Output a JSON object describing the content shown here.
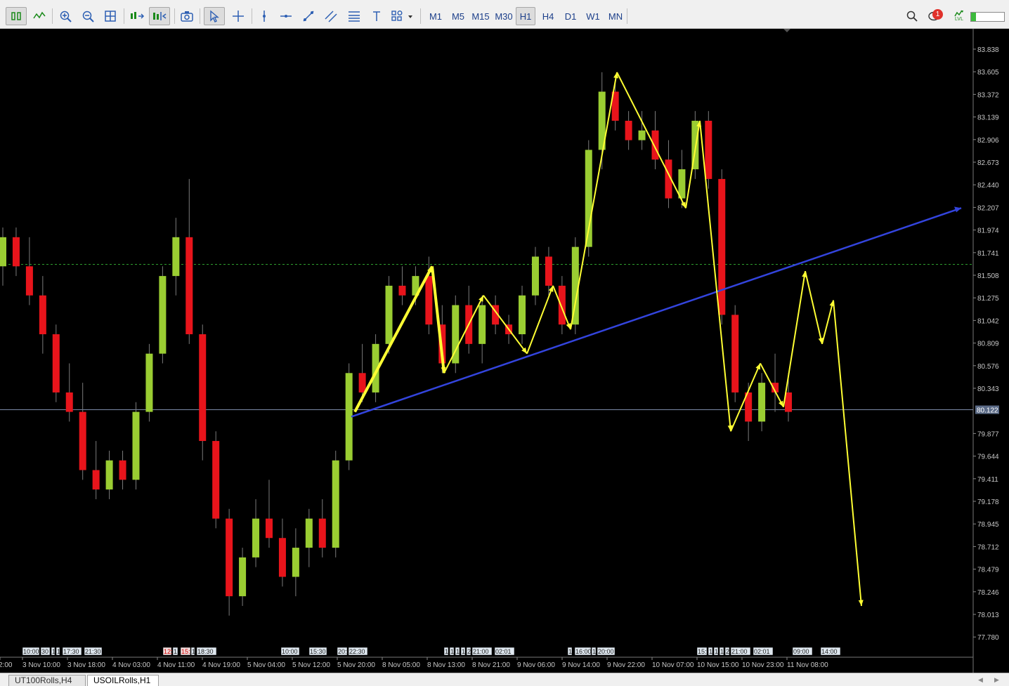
{
  "toolbar": {
    "timeframes": [
      "M1",
      "M5",
      "M15",
      "M30",
      "H1",
      "H4",
      "D1",
      "W1",
      "MN"
    ],
    "active_timeframe": "H1",
    "notification_count": "1",
    "level_label": "LVL",
    "level_fraction": 0.15
  },
  "tabs": [
    {
      "label": "UT100Rolls,H4",
      "active": false
    },
    {
      "label": "USOILRolls,H1",
      "active": true
    }
  ],
  "chart_data": {
    "type": "candlestick",
    "symbol": "USOILRolls",
    "timeframe": "H1",
    "y_axis_ticks": [
      "83.838",
      "83.605",
      "83.372",
      "83.139",
      "82.906",
      "82.673",
      "82.440",
      "82.207",
      "81.974",
      "81.741",
      "81.508",
      "81.275",
      "81.042",
      "80.809",
      "80.576",
      "80.343",
      "79.877",
      "79.644",
      "79.411",
      "79.178",
      "78.945",
      "78.712",
      "78.479",
      "78.246",
      "78.013",
      "77.780"
    ],
    "ylim": [
      77.6,
      83.95
    ],
    "current_price": "80.122",
    "dashed_level": 81.62,
    "x_axis_labels": [
      "2:00",
      "3 Nov 10:00",
      "3 Nov 18:00",
      "4 Nov 03:00",
      "4 Nov 11:00",
      "4 Nov 19:00",
      "5 Nov 04:00",
      "5 Nov 12:00",
      "5 Nov 20:00",
      "8 Nov 05:00",
      "8 Nov 13:00",
      "8 Nov 21:00",
      "9 Nov 06:00",
      "9 Nov 14:00",
      "9 Nov 22:00",
      "10 Nov 07:00",
      "10 Nov 15:00",
      "10 Nov 23:00",
      "11 Nov 08:00"
    ],
    "event_markers": [
      "10:00",
      "30",
      "1",
      "1",
      "17:30",
      "21:30",
      "12:",
      "1",
      "15:",
      "1",
      "18:30",
      "10:00",
      "15:30",
      "20:",
      "22:30",
      "1",
      "1",
      "1",
      "1",
      "2",
      "21:00",
      "02:01",
      "1",
      "16:00",
      "1",
      "20:00",
      "15:",
      "1",
      "1",
      "1",
      "2",
      "21:00",
      "02:01",
      "09:00",
      "14:00"
    ],
    "colors": {
      "bull": "#9acd32",
      "bear": "#e8141b",
      "wick": "#7a7a7a",
      "trend": "#3344dd",
      "projection": "#ffff33",
      "dashed": "#2e9e2e",
      "price_line": "#7c8aa8"
    },
    "candles_ohlc_approx": [
      [
        81.6,
        82.0,
        81.4,
        81.9
      ],
      [
        81.9,
        82.0,
        81.5,
        81.6
      ],
      [
        81.6,
        81.9,
        81.2,
        81.3
      ],
      [
        81.3,
        81.5,
        80.7,
        80.9
      ],
      [
        80.9,
        81.0,
        80.2,
        80.3
      ],
      [
        80.3,
        80.6,
        80.0,
        80.1
      ],
      [
        80.1,
        80.4,
        79.4,
        79.5
      ],
      [
        79.5,
        79.8,
        79.2,
        79.3
      ],
      [
        79.3,
        79.7,
        79.2,
        79.6
      ],
      [
        79.6,
        79.7,
        79.3,
        79.4
      ],
      [
        79.4,
        80.2,
        79.3,
        80.1
      ],
      [
        80.1,
        80.8,
        80.0,
        80.7
      ],
      [
        80.7,
        81.6,
        80.6,
        81.5
      ],
      [
        81.5,
        82.1,
        81.3,
        81.9
      ],
      [
        81.9,
        82.5,
        80.8,
        80.9
      ],
      [
        80.9,
        81.0,
        79.6,
        79.8
      ],
      [
        79.8,
        79.9,
        78.9,
        79.0
      ],
      [
        79.0,
        79.1,
        78.0,
        78.2
      ],
      [
        78.2,
        78.7,
        78.1,
        78.6
      ],
      [
        78.6,
        79.2,
        78.5,
        79.0
      ],
      [
        79.0,
        79.4,
        78.7,
        78.8
      ],
      [
        78.8,
        79.0,
        78.3,
        78.4
      ],
      [
        78.4,
        78.9,
        78.2,
        78.7
      ],
      [
        78.7,
        79.1,
        78.5,
        79.0
      ],
      [
        79.0,
        79.2,
        78.6,
        78.7
      ],
      [
        78.7,
        79.7,
        78.6,
        79.6
      ],
      [
        79.6,
        80.6,
        79.5,
        80.5
      ],
      [
        80.5,
        80.8,
        80.2,
        80.3
      ],
      [
        80.3,
        80.9,
        80.2,
        80.8
      ],
      [
        80.8,
        81.5,
        80.7,
        81.4
      ],
      [
        81.4,
        81.6,
        81.2,
        81.3
      ],
      [
        81.3,
        81.6,
        81.2,
        81.5
      ],
      [
        81.5,
        81.7,
        80.9,
        81.0
      ],
      [
        81.0,
        81.2,
        80.5,
        80.6
      ],
      [
        80.6,
        81.3,
        80.5,
        81.2
      ],
      [
        81.2,
        81.4,
        80.7,
        80.8
      ],
      [
        80.8,
        81.3,
        80.6,
        81.2
      ],
      [
        81.2,
        81.3,
        80.9,
        81.0
      ],
      [
        81.0,
        81.1,
        80.8,
        80.9
      ],
      [
        80.9,
        81.4,
        80.8,
        81.3
      ],
      [
        81.3,
        81.8,
        81.2,
        81.7
      ],
      [
        81.7,
        81.8,
        81.3,
        81.4
      ],
      [
        81.4,
        81.5,
        80.9,
        81.0
      ],
      [
        81.0,
        81.9,
        80.9,
        81.8
      ],
      [
        81.8,
        82.9,
        81.7,
        82.8
      ],
      [
        82.8,
        83.6,
        82.6,
        83.4
      ],
      [
        83.4,
        83.5,
        83.0,
        83.1
      ],
      [
        83.1,
        83.2,
        82.8,
        82.9
      ],
      [
        82.9,
        83.2,
        82.8,
        83.0
      ],
      [
        83.0,
        83.2,
        82.6,
        82.7
      ],
      [
        82.7,
        82.9,
        82.2,
        82.3
      ],
      [
        82.3,
        82.8,
        82.2,
        82.6
      ],
      [
        82.6,
        83.2,
        82.5,
        83.1
      ],
      [
        83.1,
        83.2,
        82.4,
        82.5
      ],
      [
        82.5,
        82.6,
        81.0,
        81.1
      ],
      [
        81.1,
        81.2,
        80.2,
        80.3
      ],
      [
        80.3,
        80.4,
        79.8,
        80.0
      ],
      [
        80.0,
        80.5,
        79.9,
        80.4
      ],
      [
        80.4,
        80.7,
        80.1,
        80.3
      ],
      [
        80.3,
        80.5,
        80.0,
        80.1
      ]
    ],
    "trendline": {
      "from": [
        "5 Nov 20:00",
        80.05
      ],
      "to": [
        "11 Nov 14:00",
        82.2
      ]
    },
    "projection_path_prices": [
      80.1,
      81.6,
      80.5,
      81.3,
      80.7,
      80.9,
      81.4,
      80.95,
      81.7,
      80.9,
      83.6,
      82.2,
      83.1,
      79.9,
      80.6,
      80.15,
      81.55,
      80.8,
      81.25,
      78.1
    ]
  }
}
